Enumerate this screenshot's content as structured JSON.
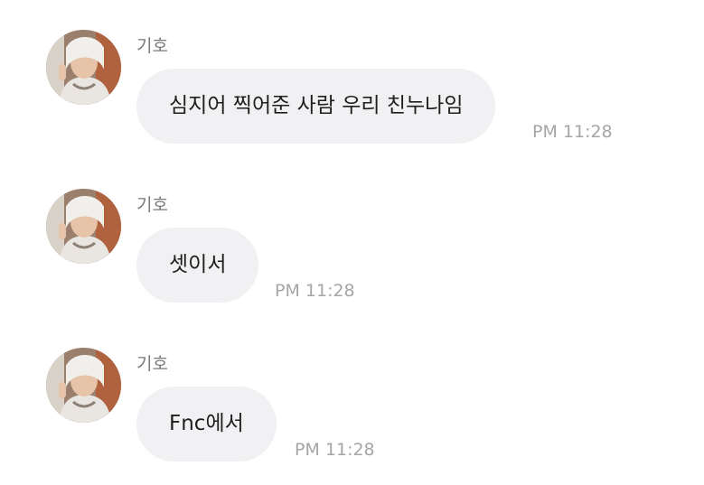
{
  "messages": [
    {
      "sender": "기호",
      "avatar_icon": "profile-photo",
      "text": "심지어 찍어준 사람 우리 친누나임",
      "time": "PM 11:28"
    },
    {
      "sender": "기호",
      "avatar_icon": "profile-photo",
      "text": "셋이서",
      "time": "PM 11:28"
    },
    {
      "sender": "기호",
      "avatar_icon": "profile-photo",
      "text": "Fnc에서",
      "time": "PM 11:28"
    }
  ],
  "colors": {
    "bubble": "#f1f1f3",
    "sender": "#7a7a7a",
    "time": "#a6a6a6",
    "text": "#1f1f1f"
  }
}
